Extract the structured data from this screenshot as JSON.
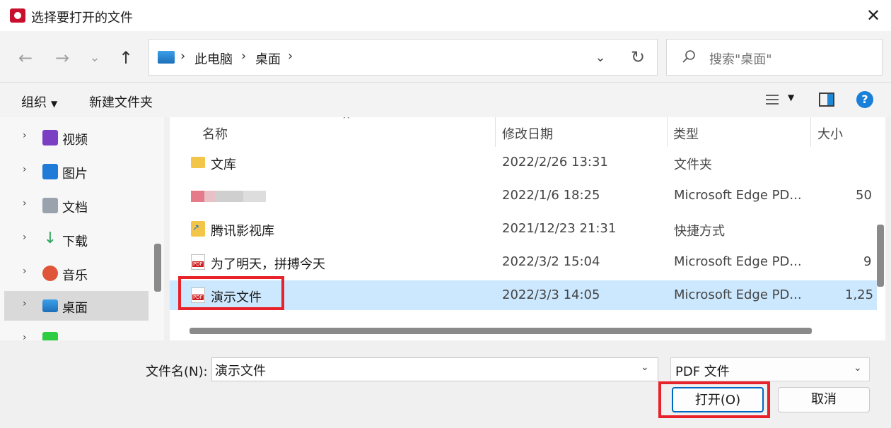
{
  "window": {
    "title": "选择要打开的文件",
    "close": "✕"
  },
  "nav": {
    "back": "←",
    "forward": "→",
    "recent": "⌄",
    "up": "↑",
    "breadcrumb": [
      "此电脑",
      "桌面"
    ],
    "separator": "›",
    "dropdown": "⌄",
    "refresh": "↻",
    "search_placeholder": "搜索\"桌面\""
  },
  "toolbar": {
    "organize": "组织",
    "new_folder": "新建文件夹",
    "help": "?"
  },
  "sidebar": {
    "items": [
      {
        "label": "视频",
        "icon": "video-icon",
        "color": "#7b3fc4"
      },
      {
        "label": "图片",
        "icon": "picture-icon",
        "color": "#1f7ad8"
      },
      {
        "label": "文档",
        "icon": "document-icon",
        "color": "#9aa3ad"
      },
      {
        "label": "下载",
        "icon": "download-icon",
        "color": "#2aa35a"
      },
      {
        "label": "音乐",
        "icon": "music-icon",
        "color": "#e0553a"
      },
      {
        "label": "桌面",
        "icon": "desktop-icon",
        "color": "#1e90d8",
        "selected": true
      },
      {
        "label": "",
        "icon": "iqiyi-icon",
        "color": "#2ecc40"
      }
    ]
  },
  "columns": {
    "name": "名称",
    "modified": "修改日期",
    "type": "类型",
    "size": "大小",
    "sort": "^"
  },
  "files": [
    {
      "name": "文库",
      "modified": "2022/2/26 13:31",
      "type": "文件夹",
      "size": "",
      "icon": "folder-icon"
    },
    {
      "name": "",
      "modified": "2022/1/6 18:25",
      "type": "Microsoft Edge PD...",
      "size": "50",
      "icon": "blurred-icon"
    },
    {
      "name": "腾讯影视库",
      "modified": "2021/12/23 21:31",
      "type": "快捷方式",
      "size": "",
      "icon": "shortcut-icon"
    },
    {
      "name": "为了明天，拼搏今天",
      "modified": "2022/3/2 15:04",
      "type": "Microsoft Edge PD...",
      "size": "9",
      "icon": "pdf-icon"
    },
    {
      "name": "演示文件",
      "modified": "2022/3/3 14:05",
      "type": "Microsoft Edge PD...",
      "size": "1,25",
      "icon": "pdf-icon",
      "selected": true
    }
  ],
  "footer": {
    "filename_label": "文件名(N):",
    "filename_value": "演示文件",
    "filter_value": "PDF 文件",
    "caret": "⌄",
    "open": "打开(O)",
    "cancel": "取消"
  }
}
